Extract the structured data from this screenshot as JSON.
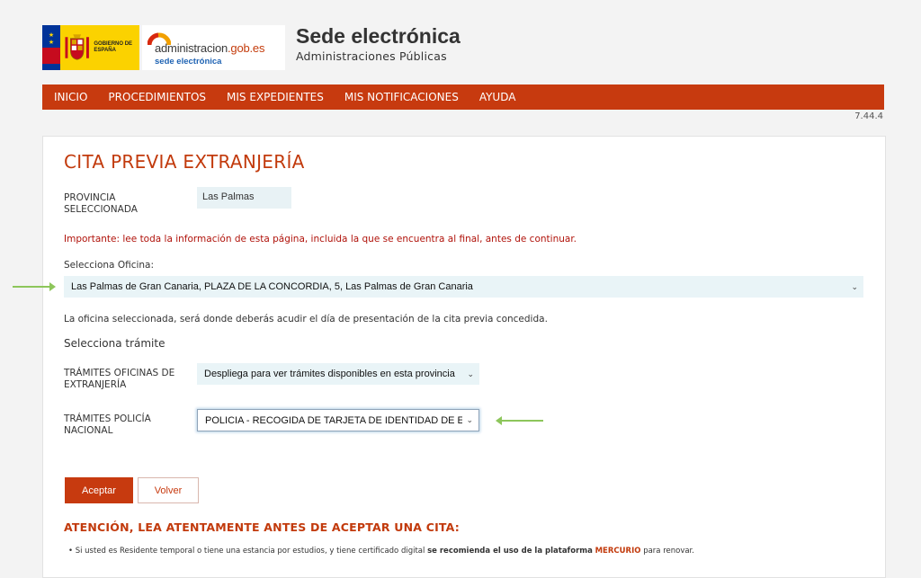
{
  "header": {
    "gov_logo_text": "GOBIERNO DE ESPAÑA",
    "admin_logo_main_part1": "administracion",
    "admin_logo_main_part2": ".gob.es",
    "admin_logo_sub": "sede electrónica",
    "site_title": "Sede electrónica",
    "site_subtitle": "Administraciones Públicas"
  },
  "nav": {
    "items": [
      "INICIO",
      "PROCEDIMIENTOS",
      "MIS EXPEDIENTES",
      "MIS NOTIFICACIONES",
      "AYUDA"
    ]
  },
  "version": "7.44.4",
  "form": {
    "title": "CITA PREVIA EXTRANJERÍA",
    "province_label_line1": "PROVINCIA",
    "province_label_line2": "SELECCIONADA",
    "province_value": "Las Palmas",
    "important_notice": "Importante: lee toda la información de esta página, incluida la que se encuentra al final, antes de continuar.",
    "office_label": "Selecciona Oficina:",
    "office_value": "Las Palmas de Gran Canaria, PLAZA DE LA CONCORDIA, 5, Las Palmas de Gran Canaria",
    "office_note": "La oficina seleccionada, será donde deberás acudir el día de presentación de la cita previa concedida.",
    "tramite_heading": "Selecciona trámite",
    "ext_label_line1": "TRÁMITES OFICINAS DE",
    "ext_label_line2": "EXTRANJERÍA",
    "ext_value": "Despliega para ver trámites disponibles en esta provincia",
    "police_label_line1": "TRÁMITES POLICÍA",
    "police_label_line2": "NACIONAL",
    "police_value": "POLICIA - RECOGIDA DE TARJETA DE IDENTIDAD DE EXTRANJERO (TIE)",
    "accept_label": "Aceptar",
    "back_label": "Volver"
  },
  "attention": {
    "heading": "ATENCIÓN, LEA ATENTAMENTE ANTES DE ACEPTAR UNA CITA:",
    "bullet_part1": "• Si usted es Residente temporal o tiene una estancia por estudios, y tiene certificado digital",
    "bullet_bold": "se recomienda el uso de la plataforma",
    "bullet_link": "MERCURIO",
    "bullet_part2": "para renovar."
  },
  "colors": {
    "brand_red": "#c73a0f",
    "notice_red": "#b0120a",
    "arrow_green": "#8dc65b",
    "field_bg": "#e9f4f7"
  }
}
